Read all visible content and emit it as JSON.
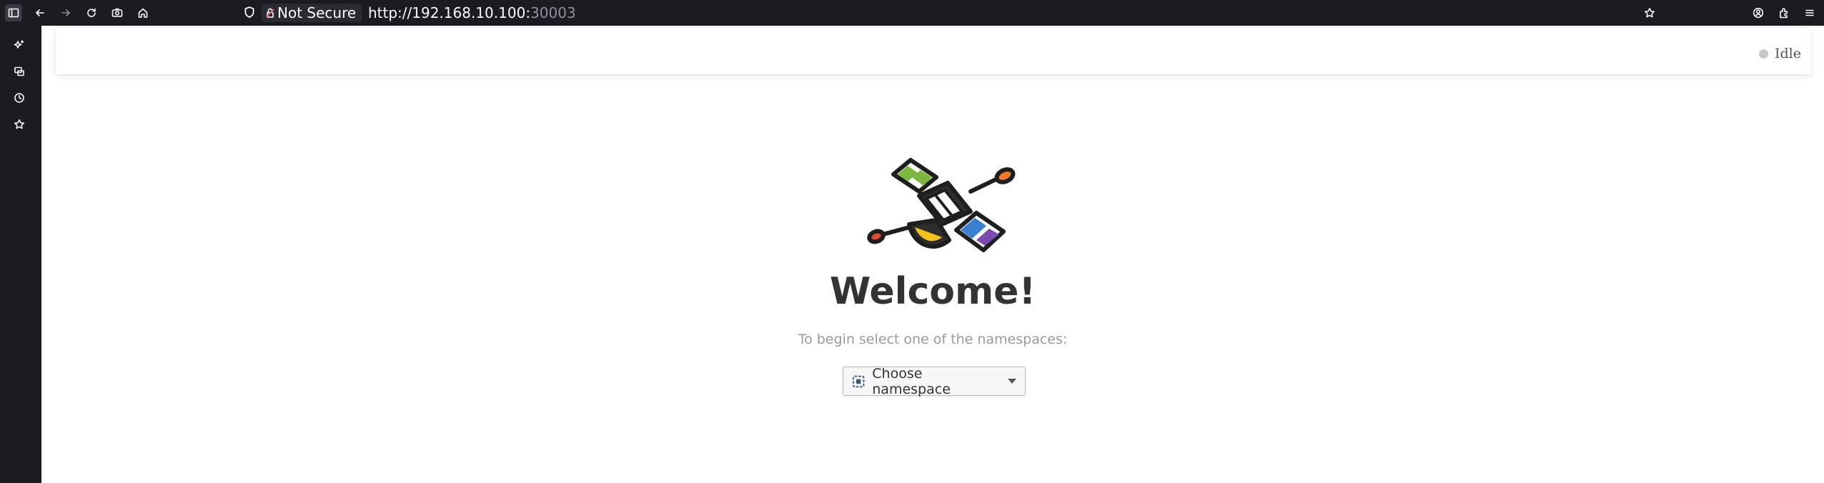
{
  "browser": {
    "security_label": "Not Secure",
    "url_host": "http://192.168.10.100:",
    "url_port": "30003",
    "icons": [
      "sidebar-toggle-icon",
      "back-icon",
      "forward-icon",
      "reload-icon",
      "screenshot-icon",
      "home-icon",
      "shield-icon",
      "lock-icon",
      "bookmark-star-icon",
      "account-icon",
      "extensions-icon",
      "menu-icon"
    ]
  },
  "sidebar": {
    "icons": [
      "ai-sparkle-icon",
      "synced-tabs-icon",
      "history-icon",
      "bookmarks-icon"
    ]
  },
  "header": {
    "status_text": "Idle",
    "status_color": "#c8c8c8"
  },
  "main": {
    "title": "Welcome!",
    "subtitle": "To begin select one of the namespaces:",
    "namespace_button_label": "Choose namespace"
  },
  "colors": {
    "browser_bg": "#1c1b22",
    "title_color": "#333333",
    "subtitle_color": "#9a9a9a"
  }
}
